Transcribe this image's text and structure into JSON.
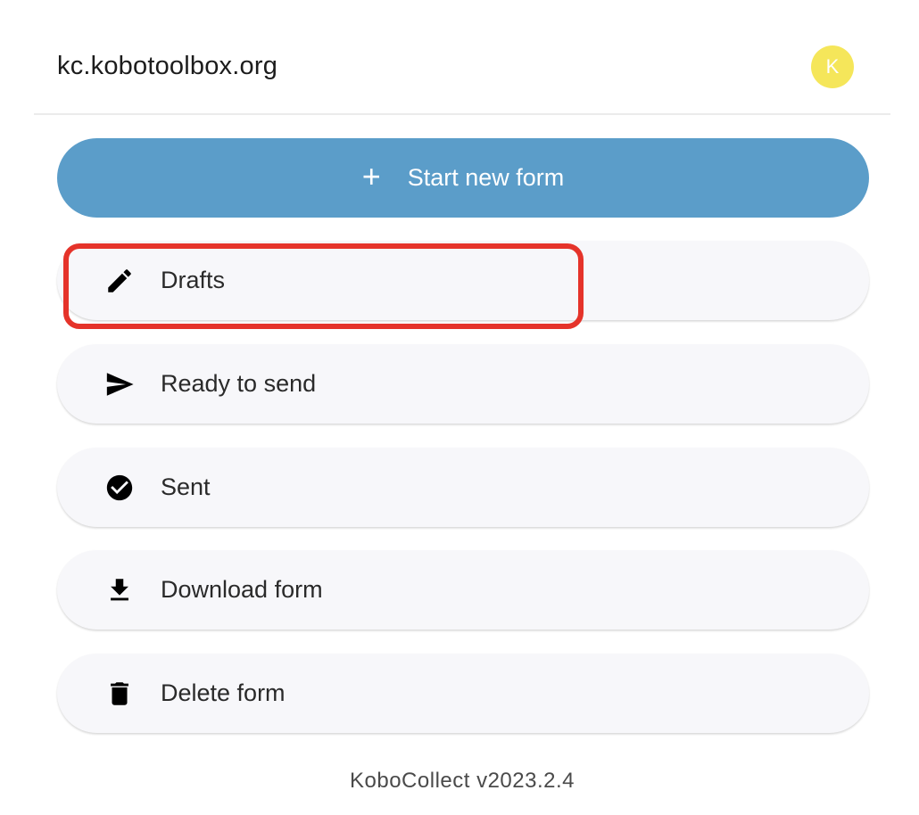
{
  "header": {
    "server": "kc.kobotoolbox.org",
    "avatar_initial": "K"
  },
  "main": {
    "start_button": {
      "icon": "plus-icon",
      "label": "Start new form"
    },
    "menu": [
      {
        "key": "drafts",
        "icon": "pencil-icon",
        "label": "Drafts",
        "highlighted": true
      },
      {
        "key": "ready",
        "icon": "send-icon",
        "label": "Ready to send"
      },
      {
        "key": "sent",
        "icon": "check-circle-icon",
        "label": "Sent"
      },
      {
        "key": "download",
        "icon": "download-icon",
        "label": "Download form"
      },
      {
        "key": "delete",
        "icon": "trash-icon",
        "label": "Delete form"
      }
    ]
  },
  "footer": {
    "version": "KoboCollect v2023.2.4"
  },
  "colors": {
    "primary": "#5b9dc9",
    "avatar": "#f5e65a",
    "highlight": "#e5332a",
    "button_bg": "#f7f7fa"
  }
}
